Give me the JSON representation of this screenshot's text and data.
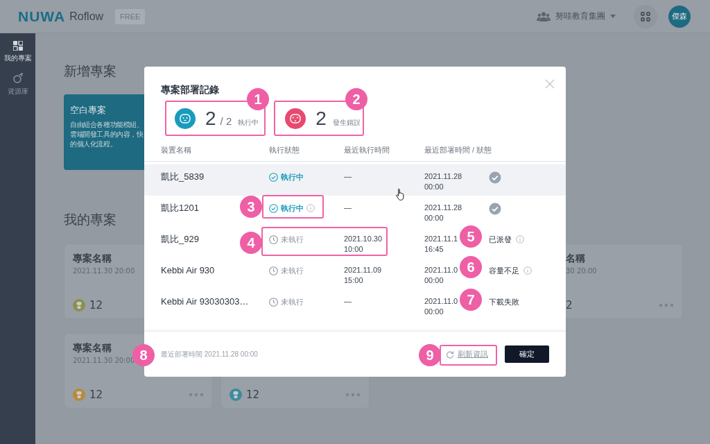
{
  "topbar": {
    "logo": "NUWA",
    "app_name": "Roflow",
    "plan_badge": "FREE",
    "organization": "努哇教育集團",
    "avatar": "傑森"
  },
  "sidebar": {
    "items": [
      {
        "kind": "projects",
        "label": "我的專案",
        "selected": true
      },
      {
        "kind": "library",
        "label": "資源庫",
        "selected": false
      }
    ]
  },
  "new_project": {
    "heading": "新增專案",
    "blank_card": {
      "title": "空白專案",
      "description_lines": [
        "自由組合各種功能模組、",
        "雲端開發工具的內容，快",
        "的個人化流程。"
      ]
    }
  },
  "my_projects": {
    "heading": "我的專案",
    "cards": [
      {
        "title": "專案名稱",
        "date": "2021.11.30 20:00",
        "count": "12",
        "color": "#8a9150"
      },
      {
        "title": "名稱",
        "date": "30 20:00",
        "count": "2",
        "menu": true
      },
      {
        "title": "專案名稱",
        "date": "2021.11.30 20:00",
        "count": "12",
        "color": "#b88a3d",
        "menu": true
      },
      {
        "count": "12",
        "color": "#3f8aa0",
        "menu": true
      }
    ]
  },
  "dialog": {
    "title": "專案部署記錄",
    "stats": [
      {
        "kind": "running",
        "count": "2",
        "total": "/ 2",
        "label": "執行中"
      },
      {
        "kind": "error",
        "count": "2",
        "label": "發生錯誤"
      }
    ],
    "columns": [
      "裝置名稱",
      "執行狀態",
      "最近執行時間",
      "最近部署時間 / 狀態"
    ],
    "rows": [
      {
        "device": "凱比_5839",
        "highlighted": true,
        "status": {
          "kind": "running",
          "label": "執行中",
          "info": false
        },
        "last_run": [
          "—"
        ],
        "deployed": [
          "2021.11.28",
          "00:00"
        ],
        "result": {
          "kind": "done"
        }
      },
      {
        "device": "凱比1201",
        "highlighted": false,
        "status": {
          "kind": "running",
          "label": "執行中",
          "info": true
        },
        "last_run": [
          "—"
        ],
        "deployed": [
          "2021.11.28",
          "00:00"
        ],
        "result": {
          "kind": "done"
        }
      },
      {
        "device": "凱比_929",
        "highlighted": false,
        "status": {
          "kind": "idle",
          "label": "未執行",
          "info": false
        },
        "last_run": [
          "2021.10.30",
          "10:00"
        ],
        "deployed": [
          "2021.11.1",
          "16:45"
        ],
        "result": {
          "kind": "text",
          "label": "已派發",
          "info": true
        }
      },
      {
        "device": "Kebbi Air 930",
        "highlighted": false,
        "status": {
          "kind": "idle",
          "label": "未執行",
          "info": false
        },
        "last_run": [
          "2021.11.09",
          "15:00"
        ],
        "deployed": [
          "2021.11.0",
          "00:00"
        ],
        "result": {
          "kind": "text",
          "label": "容量不足",
          "info": true
        }
      },
      {
        "device": "Kebbi Air 93030303…",
        "highlighted": false,
        "status": {
          "kind": "idle",
          "label": "未執行",
          "info": false
        },
        "last_run": [
          "—"
        ],
        "deployed": [
          "2021.11.0",
          "00:00"
        ],
        "result": {
          "kind": "text",
          "label": "下載失敗",
          "info": false
        }
      }
    ],
    "footer_note": "最近部署時間 2021.11.28 00:00",
    "refresh_link": "刷新資訊",
    "confirm_button": "確定"
  },
  "annotations": [
    "1",
    "2",
    "3",
    "4",
    "5",
    "6",
    "7",
    "8",
    "9"
  ]
}
